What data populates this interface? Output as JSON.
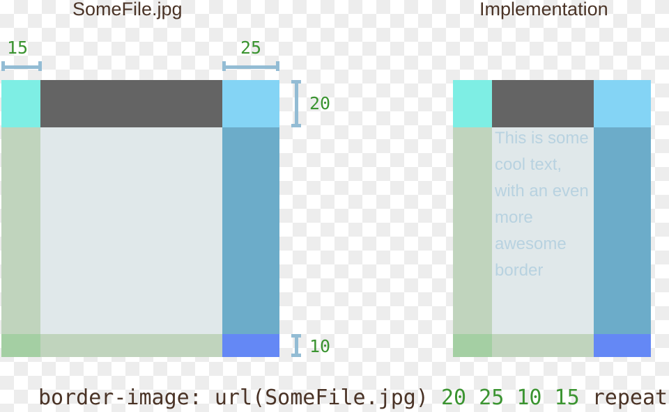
{
  "titles": {
    "left": "SomeFile.jpg",
    "right": "Implementation"
  },
  "dimensions": {
    "left_slice": "15",
    "right_slice": "25",
    "top_slice": "20",
    "bottom_slice": "10"
  },
  "implementation": {
    "body_text": "This is some cool text, with an even more awesome border"
  },
  "caption": {
    "property": "border-image:",
    "url": "url(SomeFile.jpg)",
    "values": "20 25 10 15",
    "keyword": "repeat"
  },
  "colors": {
    "corner_top_left": "#7eeee4",
    "edge_top": "#646464",
    "corner_top_right": "#84d4f5",
    "edge_left": "#c0d4bd",
    "center": "#e0e8ea",
    "edge_right": "#6cacc9",
    "corner_bottom_left": "#a4cfa3",
    "edge_bottom": "#c0d4bd",
    "corner_bottom_right": "#6488f5",
    "measure_line": "#93bcd4",
    "dim_text": "#3b9431",
    "title_text": "#4a3326",
    "body_text": "#b8d2e0",
    "checker_light": "#ffffff",
    "checker_dark": "#ededed"
  }
}
